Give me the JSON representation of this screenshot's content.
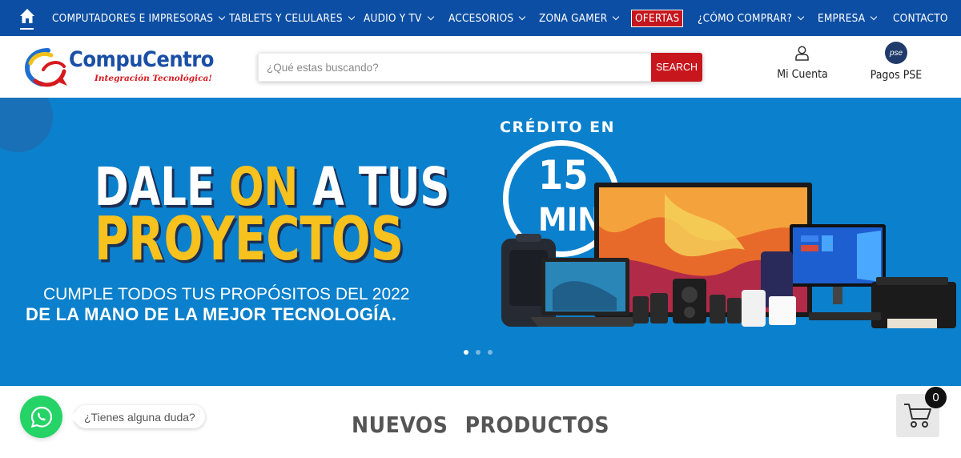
{
  "nav": {
    "items": [
      {
        "label": "COMPUTADORES E IMPRESORAS",
        "dropdown": true
      },
      {
        "label": "TABLETS Y CELULARES",
        "dropdown": true
      },
      {
        "label": "AUDIO Y TV",
        "dropdown": true
      },
      {
        "label": "ACCESORIOS",
        "dropdown": true
      },
      {
        "label": "ZONA GAMER",
        "dropdown": true
      },
      {
        "label": "OFERTAS",
        "dropdown": false,
        "highlight": true
      },
      {
        "label": "¿CÓMO COMPRAR?",
        "dropdown": true
      },
      {
        "label": "EMPRESA",
        "dropdown": true
      },
      {
        "label": "CONTACTO",
        "dropdown": false
      }
    ],
    "background": "#0c4ea3",
    "home_icon": "home-icon"
  },
  "header": {
    "logo_name": "CompuCentro",
    "logo_tagline": "Integración Tecnológica!",
    "search_placeholder": "¿Qué estas buscando?",
    "search_button": "SEARCH",
    "account_label": "Mi Cuenta",
    "account_icon": "user-icon",
    "pse_badge": "pse",
    "pse_label": "Pagos PSE"
  },
  "hero": {
    "line1_pre": "DALE ",
    "line1_highlight": "ON",
    "line1_post": " A TUS",
    "line2": "PROYECTOS",
    "sub1": "CUMPLE TODOS TUS PROPÓSITOS DEL 2022",
    "sub2": "DE LA MANO DE LA MEJOR TECNOLOGÍA.",
    "credit_label": "CRÉDITO  EN",
    "clock_number": "15",
    "clock_unit": "MIN",
    "slide_count": 3,
    "active_slide": 1,
    "background": "#0b80cc",
    "accent": "#f7c11e"
  },
  "section": {
    "title": "NUEVOS PRODUCTOS"
  },
  "whatsapp": {
    "tooltip": "¿Tienes alguna duda?",
    "icon": "whatsapp-icon",
    "color": "#25d366"
  },
  "cart": {
    "count": "0",
    "icon": "cart-icon"
  }
}
